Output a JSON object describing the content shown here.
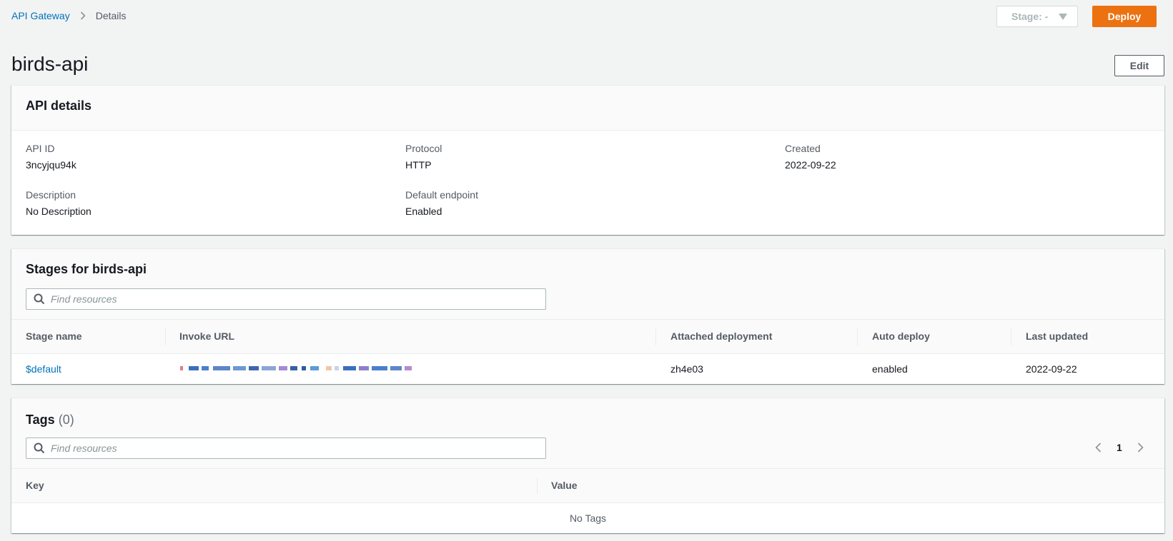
{
  "breadcrumb": {
    "root": "API Gateway",
    "current": "Details"
  },
  "topbar": {
    "stage_label": "Stage: -",
    "deploy_label": "Deploy"
  },
  "page": {
    "title": "birds-api",
    "edit_label": "Edit"
  },
  "details": {
    "title": "API details",
    "api_id_label": "API ID",
    "api_id": "3ncyjqu94k",
    "protocol_label": "Protocol",
    "protocol": "HTTP",
    "created_label": "Created",
    "created": "2022-09-22",
    "description_label": "Description",
    "description": "No Description",
    "endpoint_label": "Default endpoint",
    "endpoint": "Enabled"
  },
  "stages": {
    "title": "Stages for birds-api",
    "search_placeholder": "Find resources",
    "columns": [
      "Stage name",
      "Invoke URL",
      "Attached deployment",
      "Auto deploy",
      "Last updated"
    ],
    "rows": [
      {
        "stage_name": "$default",
        "invoke_url": "",
        "deployment": "zh4e03",
        "auto_deploy": "enabled",
        "last_updated": "2022-09-22"
      }
    ]
  },
  "tags": {
    "title": "Tags",
    "count": "(0)",
    "search_placeholder": "Find resources",
    "columns": [
      "Key",
      "Value"
    ],
    "empty": "No Tags",
    "page": "1"
  },
  "colors": {
    "accent_orange": "#ec7211",
    "link_blue": "#0073bb",
    "background": "#f2f3f3"
  },
  "icons": {
    "breadcrumb_separator": "chevron-right-icon",
    "stage_caret": "caret-down-icon",
    "search": "search-icon",
    "pager_prev": "chevron-left-icon",
    "pager_next": "chevron-right-icon"
  }
}
